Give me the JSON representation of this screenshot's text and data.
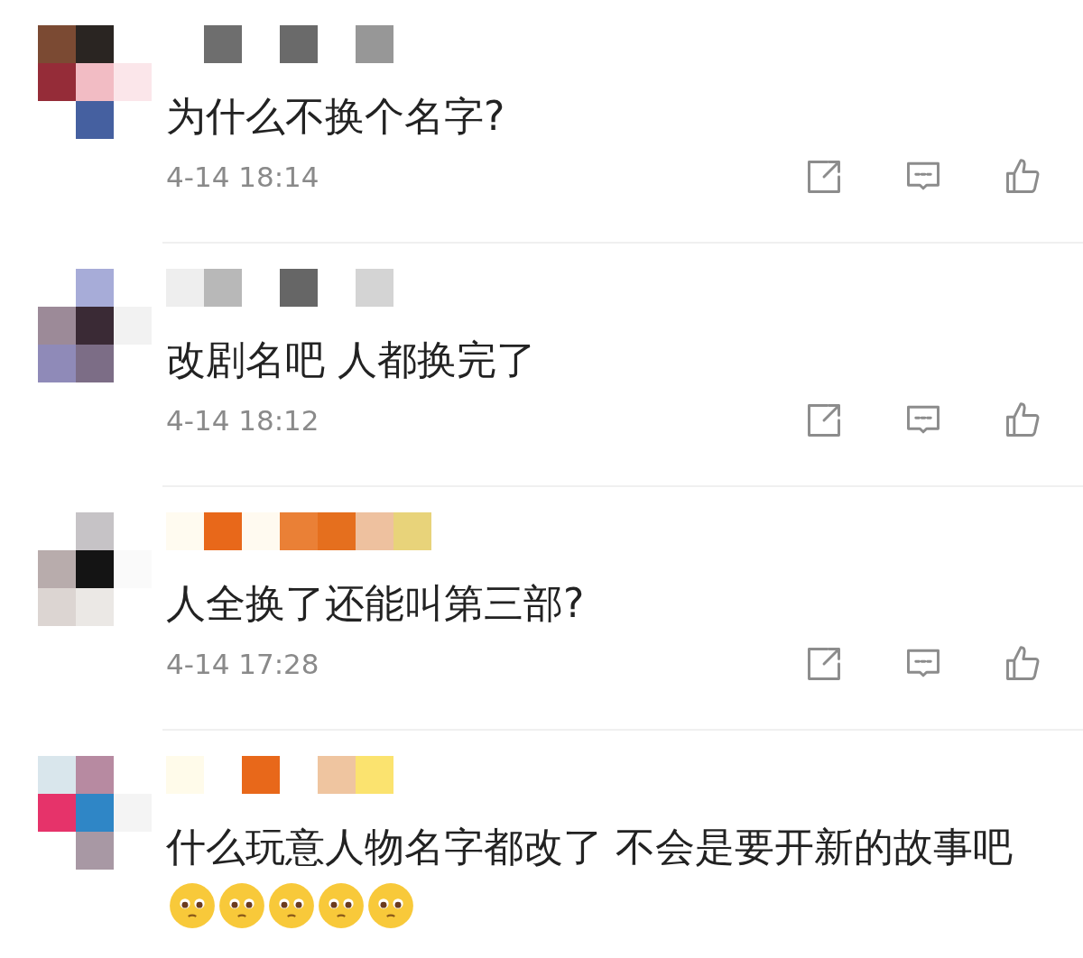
{
  "comments": [
    {
      "text": "为什么不换个名字?",
      "time": "4-14 18:14"
    },
    {
      "text": "改剧名吧 人都换完了",
      "time": "4-14 18:12"
    },
    {
      "text": "人全换了还能叫第三部?",
      "time": "4-14 17:28"
    },
    {
      "text": "什么玩意人物名字都改了 不会是要开新的故事吧",
      "emojis": [
        {
          "kind": "pleading"
        },
        {
          "kind": "pleading"
        },
        {
          "kind": "pleading"
        },
        {
          "kind": "pleading"
        },
        {
          "kind": "pleading"
        }
      ]
    }
  ]
}
